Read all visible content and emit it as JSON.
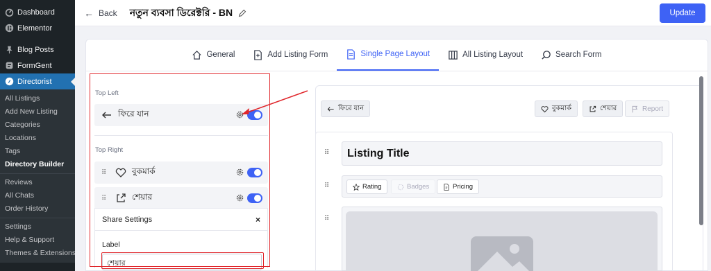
{
  "sidebar": {
    "top": [
      {
        "label": "Dashboard",
        "icon": "dashboard-icon"
      },
      {
        "label": "Elementor",
        "icon": "elementor-icon"
      }
    ],
    "mid": [
      {
        "label": "Blog Posts",
        "icon": "pin-icon"
      },
      {
        "label": "FormGent",
        "icon": "formgent-icon"
      },
      {
        "label": "Directorist",
        "icon": "directorist-icon"
      }
    ],
    "sub": [
      "All Listings",
      "Add New Listing",
      "Categories",
      "Locations",
      "Tags",
      "Directory Builder",
      "Reviews",
      "All Chats",
      "Order History",
      "Settings",
      "Help & Support",
      "Themes & Extensions"
    ]
  },
  "header": {
    "back_label": "Back",
    "title": "নতুন ব্যবসা ডিরেক্টরি - BN",
    "update_label": "Update"
  },
  "tabs": [
    {
      "label": "General",
      "icon": "home-icon"
    },
    {
      "label": "Add Listing Form",
      "icon": "add-form-icon"
    },
    {
      "label": "Single Page Layout",
      "icon": "document-icon",
      "active": true
    },
    {
      "label": "All Listing Layout",
      "icon": "grid-icon"
    },
    {
      "label": "Search Form",
      "icon": "search-icon"
    }
  ],
  "left_panel": {
    "top_left_label": "Top Left",
    "top_right_label": "Top Right",
    "back_item": "ফিরে যান",
    "bookmark_item": "বুকমার্ক",
    "share_item": "শেয়ার",
    "share_settings_title": "Share Settings",
    "label_field_label": "Label",
    "label_field_value": "শেয়ার"
  },
  "preview": {
    "back_button": "ফিরে যান",
    "bookmark_button": "বুকমার্ক",
    "share_button": "শেয়ার",
    "report_button": "Report",
    "listing_title": "Listing Title",
    "chips": [
      "Rating",
      "Badges",
      "Pricing"
    ]
  },
  "colors": {
    "accent": "#3e62f5",
    "sidebar_bg": "#1d2327",
    "sidebar_active": "#2271b1",
    "annotation_red": "#e0262b"
  }
}
